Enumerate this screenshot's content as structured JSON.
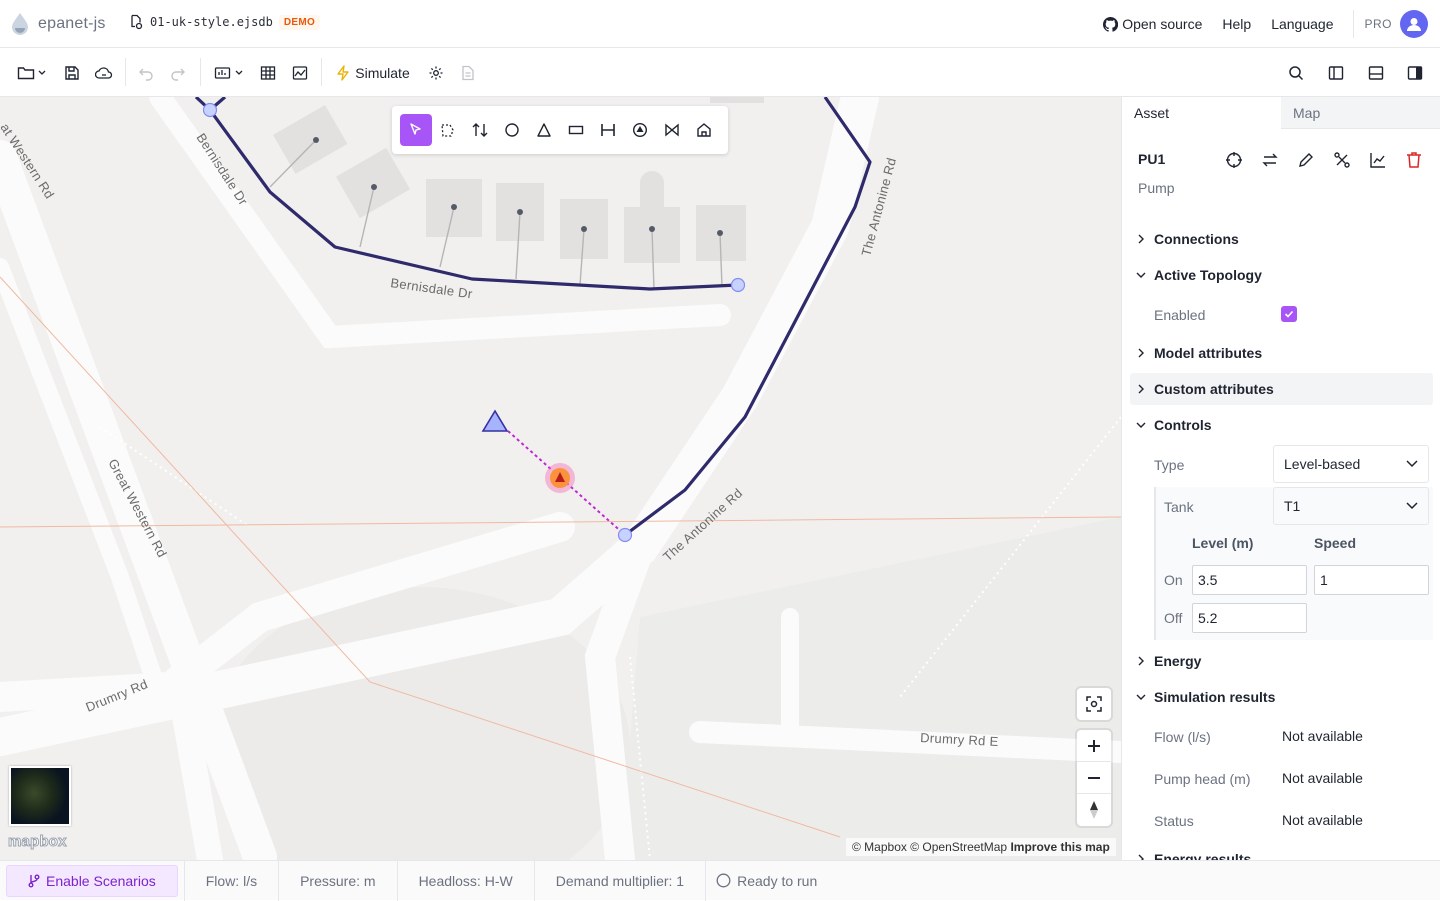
{
  "app": {
    "name": "epanet-js"
  },
  "file": {
    "name": "01-uk-style.ejsdb",
    "badge": "DEMO"
  },
  "topnav": {
    "open_source": "Open source",
    "help": "Help",
    "language": "Language",
    "plan": "PRO"
  },
  "toolbar": {
    "simulate": "Simulate"
  },
  "map": {
    "labels": {
      "gwr1": "at Western Rd",
      "bern1": "Bernisdale Dr",
      "bern2": "Bernisdale Dr",
      "antonine1": "The Antonine Rd",
      "antonine2": "The Antonine Rd",
      "gwr2": "Great Western Rd",
      "drumry": "Drumry Rd",
      "drumrye": "Drumry Rd E"
    },
    "attribution": {
      "mapbox": "© Mapbox",
      "osm": "© OpenStreetMap",
      "improve": "Improve this map"
    },
    "logo": "mapbox"
  },
  "panel": {
    "tabs": [
      "Asset",
      "Map"
    ],
    "asset": {
      "id": "PU1",
      "type": "Pump"
    },
    "sections": {
      "connections": "Connections",
      "active_topology": "Active Topology",
      "model_attributes": "Model attributes",
      "custom_attributes": "Custom attributes",
      "controls": "Controls",
      "energy": "Energy",
      "simulation_results": "Simulation results",
      "energy_results": "Energy results"
    },
    "enabled_label": "Enabled",
    "enabled": true,
    "controls": {
      "type_label": "Type",
      "type_value": "Level-based",
      "tank_label": "Tank",
      "tank_value": "T1",
      "level_header": "Level (m)",
      "speed_header": "Speed",
      "on_label": "On",
      "on_level": "3.5",
      "on_speed": "1",
      "off_label": "Off",
      "off_level": "5.2"
    },
    "results": {
      "flow_label": "Flow (l/s)",
      "flow_value": "Not available",
      "head_label": "Pump head (m)",
      "head_value": "Not available",
      "status_label": "Status",
      "status_value": "Not available"
    }
  },
  "statusbar": {
    "scenarios": "Enable Scenarios",
    "flow": "Flow: l/s",
    "pressure": "Pressure: m",
    "headloss": "Headloss: H-W",
    "demand": "Demand multiplier: 1",
    "run": "Ready to run"
  },
  "colors": {
    "accent": "#a855f7",
    "pipe": "#2e2a6b",
    "delete": "#dc2626"
  }
}
